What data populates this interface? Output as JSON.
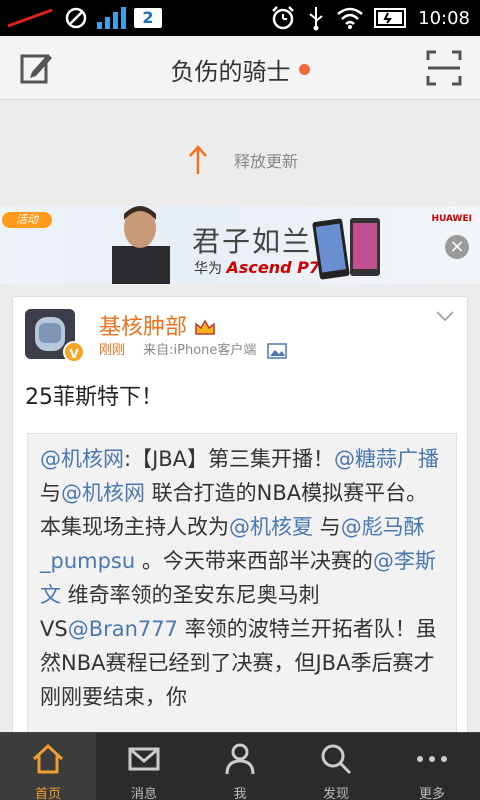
{
  "status_bar": {
    "network_badge": "2",
    "time": "10:08"
  },
  "header": {
    "title": "负伤的骑士",
    "compose_icon": "compose-icon",
    "scan_icon": "scan-icon"
  },
  "refresh": {
    "label": "释放更新"
  },
  "banner": {
    "tag": "活动",
    "title": "君子如兰",
    "sub_prefix": "华为",
    "sub_product": "Ascend P7",
    "brand": "HUAWEI"
  },
  "post": {
    "author": "基核肿部",
    "time": "刚刚",
    "source": "来自:iPhone客户端",
    "text": "25菲斯特下！",
    "repost_parts": [
      {
        "t": "@机核网",
        "m": true
      },
      {
        "t": ":【JBA】第三集开播！",
        "m": false
      },
      {
        "t": "@糖蒜广播",
        "m": true
      },
      {
        "t": " 与",
        "m": false
      },
      {
        "t": "@机核网",
        "m": true
      },
      {
        "t": " 联合打造的NBA模拟赛平台。本集现场主持人改为",
        "m": false
      },
      {
        "t": "@机核夏",
        "m": true
      },
      {
        "t": " 与",
        "m": false
      },
      {
        "t": "@彪马酥_pumpsu",
        "m": true
      },
      {
        "t": " 。今天带来西部半决赛的",
        "m": false
      },
      {
        "t": "@李斯文",
        "m": true
      },
      {
        "t": " 维奇率领的圣安东尼奥马刺VS",
        "m": false
      },
      {
        "t": "@Bran777",
        "m": true
      },
      {
        "t": " 率领的波特兰开拓者队！虽然NBA赛程已经到了决赛，但JBA季后赛才刚刚要结束，你",
        "m": false
      }
    ]
  },
  "tabs": [
    {
      "label": "首页",
      "icon": "home-icon",
      "active": true
    },
    {
      "label": "消息",
      "icon": "message-icon",
      "active": false
    },
    {
      "label": "我",
      "icon": "profile-icon",
      "active": false
    },
    {
      "label": "发现",
      "icon": "search-icon",
      "active": false
    },
    {
      "label": "更多",
      "icon": "more-icon",
      "active": false
    }
  ],
  "colors": {
    "accent": "#f0721e",
    "mention": "#4a78b0",
    "tab_active": "#f0a030"
  }
}
